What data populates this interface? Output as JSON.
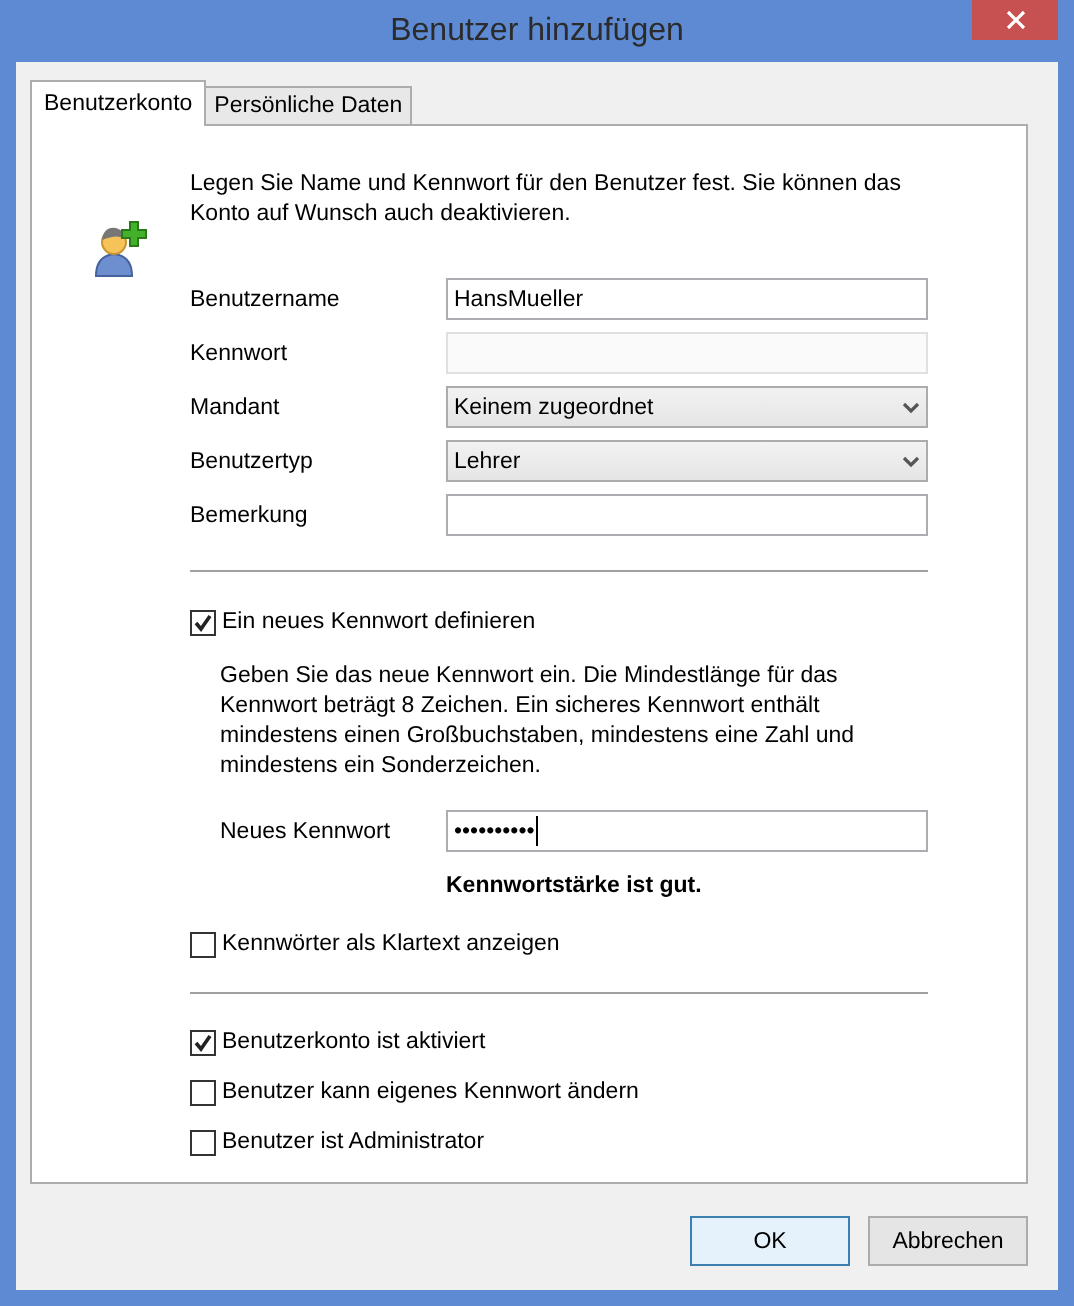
{
  "window": {
    "title": "Benutzer hinzufügen"
  },
  "tabs": [
    {
      "label": "Benutzerkonto",
      "selected": true
    },
    {
      "label": "Persönliche Daten",
      "selected": false
    }
  ],
  "intro": "Legen Sie Name und Kennwort für den Benutzer fest. Sie können das Konto auf Wunsch auch deaktivieren.",
  "fields": [
    {
      "label": "Benutzername",
      "kind": "text",
      "value": "HansMueller",
      "disabled": false
    },
    {
      "label": "Kennwort",
      "kind": "text",
      "disabled": true
    },
    {
      "label": "Mandant",
      "kind": "select",
      "value": "Keinem zugeordnet"
    },
    {
      "label": "Benutzertyp",
      "kind": "select",
      "value": "Lehrer"
    },
    {
      "label": "Bemerkung",
      "kind": "text",
      "disabled": false
    }
  ],
  "new_password": {
    "checkbox": {
      "label": "Ein neues Kennwort definieren",
      "checked": true
    },
    "hint": "Geben Sie das neue Kennwort ein. Die Mindestlänge für das Kennwort beträgt 8 Zeichen. Ein sicheres Kennwort enthält mindestens einen Großbuchstaben, mindestens eine Zahl und mindestens ein Sonderzeichen.",
    "field": {
      "label": "Neues Kennwort",
      "value": "••••••••••",
      "focused": true
    },
    "strength": "Kennwortstärke ist gut.",
    "show_plain": {
      "label": "Kennwörter als Klartext anzeigen",
      "checked": false
    }
  },
  "account_options": [
    {
      "label": "Benutzerkonto ist aktiviert",
      "checked": true
    },
    {
      "label": "Benutzer kann eigenes Kennwort ändern",
      "checked": false
    },
    {
      "label": "Benutzer ist Administrator",
      "checked": false
    }
  ],
  "buttons": [
    {
      "label": "OK",
      "default": true
    },
    {
      "label": "Abbrechen",
      "default": false
    }
  ]
}
